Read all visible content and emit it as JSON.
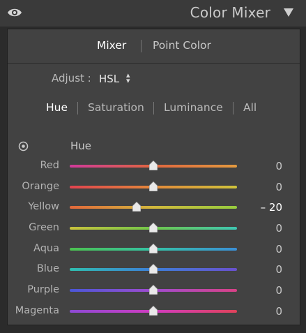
{
  "header": {
    "title": "Color Mixer",
    "eye_icon": "eye-icon",
    "collapse_icon": "triangle-down-icon"
  },
  "top_tabs": [
    {
      "label": "Mixer",
      "active": true
    },
    {
      "label": "Point Color",
      "active": false
    }
  ],
  "adjust": {
    "label": "Adjust :",
    "value": "HSL",
    "arrows_icon": "up-down-arrows-icon"
  },
  "mode_tabs": [
    {
      "label": "Hue",
      "active": true
    },
    {
      "label": "Saturation",
      "active": false
    },
    {
      "label": "Luminance",
      "active": false
    },
    {
      "label": "All",
      "active": false
    }
  ],
  "section": {
    "label": "Hue",
    "target_icon": "target-adjustment-icon"
  },
  "slider_range": [
    -100,
    100
  ],
  "sliders": [
    {
      "label": "Red",
      "value": 0,
      "display": "0",
      "gradient": [
        "#d03a9a",
        "#e0663f",
        "#e39a3f"
      ]
    },
    {
      "label": "Orange",
      "value": 0,
      "display": "0",
      "gradient": [
        "#e2434f",
        "#e4893a",
        "#cfc43b"
      ]
    },
    {
      "label": "Yellow",
      "value": -20,
      "display": "– 20",
      "gradient": [
        "#e2683b",
        "#d2b83c",
        "#97cd3e"
      ]
    },
    {
      "label": "Green",
      "value": 0,
      "display": "0",
      "gradient": [
        "#c9c23c",
        "#6fc64a",
        "#3ec6b2"
      ]
    },
    {
      "label": "Aqua",
      "value": 0,
      "display": "0",
      "gradient": [
        "#4cc24f",
        "#34c2a6",
        "#3b8fd6"
      ]
    },
    {
      "label": "Blue",
      "value": 0,
      "display": "0",
      "gradient": [
        "#2fbfb0",
        "#3d7fd9",
        "#6a51cf"
      ]
    },
    {
      "label": "Purple",
      "value": 0,
      "display": "0",
      "gradient": [
        "#4a57d8",
        "#a04bcf",
        "#d94286"
      ]
    },
    {
      "label": "Magenta",
      "value": 0,
      "display": "0",
      "gradient": [
        "#8c4ad4",
        "#d03cc0",
        "#e0425a"
      ]
    }
  ]
}
